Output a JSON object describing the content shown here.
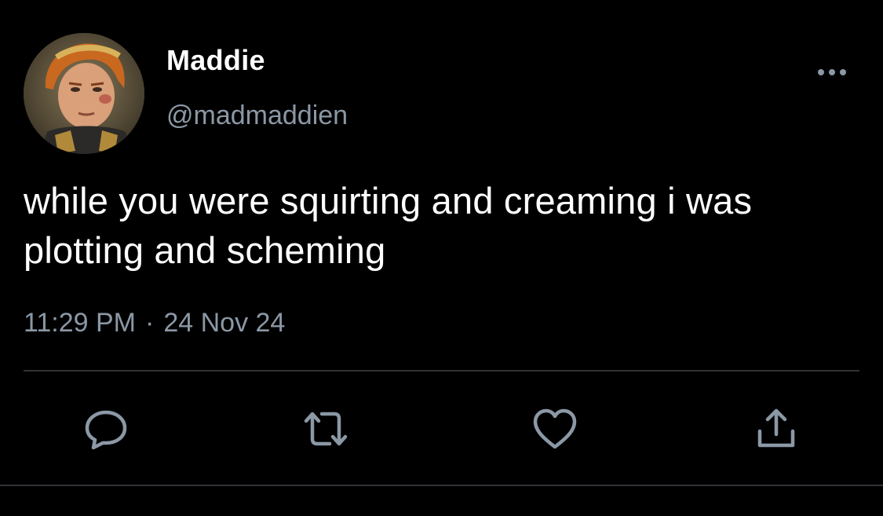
{
  "tweet": {
    "author": {
      "display_name": "Maddie",
      "handle": "@madmaddien",
      "avatar_icon": "avatar-portrait-icon"
    },
    "text": "while you were squirting and creaming i was plotting and scheming",
    "time": "11:29 PM",
    "separator": "·",
    "date": "24 Nov 24"
  },
  "actions": {
    "reply_icon": "reply-icon",
    "retweet_icon": "retweet-icon",
    "like_icon": "heart-icon",
    "share_icon": "share-icon",
    "more_icon": "more-icon"
  },
  "colors": {
    "background": "#000000",
    "primary_text": "#ffffff",
    "secondary_text": "#8b98a5",
    "divider": "#2f3336",
    "icon": "#8b98a5"
  }
}
